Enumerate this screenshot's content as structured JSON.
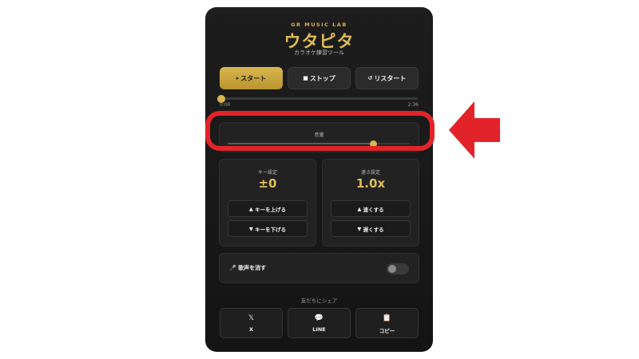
{
  "header": {
    "brand": "GR MUSIC LAB",
    "title": "ウタピタ",
    "subtitle": "カラオケ練習ツール"
  },
  "controls": {
    "start_label": "スタート",
    "stop_label": "ストップ",
    "restart_label": "リスタート"
  },
  "playback": {
    "current_time": "0:00",
    "duration": "2:36",
    "progress_fraction": 0.0
  },
  "volume": {
    "label": "音量",
    "level_fraction": 0.8
  },
  "key": {
    "label": "キー設定",
    "value": "±0",
    "up_label": "キーを上げる",
    "down_label": "キーを下げる"
  },
  "speed": {
    "label": "速さ設定",
    "value": "1.0x",
    "up_label": "速くする",
    "down_label": "遅くする"
  },
  "vocal_cut": {
    "label": "歌声を消す",
    "enabled": false
  },
  "share": {
    "label": "友だちにシェア",
    "x_label": "X",
    "line_label": "LINE",
    "copy_label": "コピー"
  },
  "colors": {
    "accent": "#d4b04a",
    "highlight": "#e2242a",
    "background": "#141414"
  },
  "icons": {
    "play": "play-icon",
    "stop": "stop-icon",
    "restart": "restart-icon",
    "mic": "mic-icon",
    "x": "x-logo-icon",
    "line": "speech-bubble-icon",
    "copy": "clipboard-icon",
    "arrow": "arrow-left-icon"
  }
}
